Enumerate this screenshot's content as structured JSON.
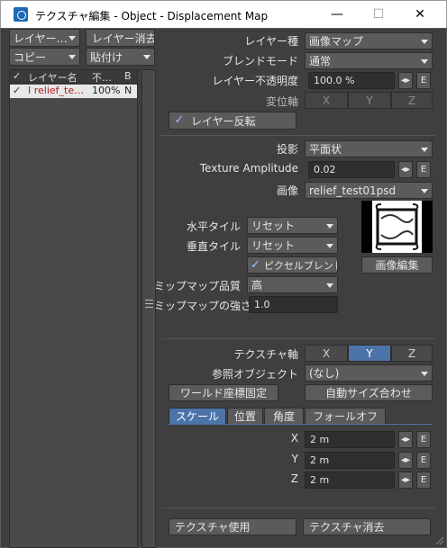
{
  "window": {
    "title": "テクスチャ編集 - Object - Displacement Map",
    "minimize": "—",
    "maximize": "☐",
    "close": "✕"
  },
  "left": {
    "layer_menu": "レイヤー…",
    "layer_delete": "レイヤー消去",
    "copy": "コピー",
    "paste": "貼付け",
    "col_check": "✓",
    "col_name": "レイヤー名",
    "col_opacity": "不…",
    "col_blend": "B",
    "rows": [
      {
        "check": "✓",
        "name": "I relief_te…",
        "opacity": "100%",
        "blend": "N"
      }
    ]
  },
  "layer": {
    "type_label": "レイヤー種",
    "type_value": "画像マップ",
    "blend_label": "ブレンドモード",
    "blend_value": "通常",
    "opacity_label": "レイヤー不透明度",
    "opacity_value": "100.0 %",
    "axis_label": "変位軸",
    "axis_x": "X",
    "axis_y": "Y",
    "axis_z": "Z",
    "invert_label": "レイヤー反転",
    "invert_check": "✓"
  },
  "image": {
    "projection_label": "投影",
    "projection_value": "平面状",
    "amp_label": "Texture Amplitude",
    "amp_value": "0.02",
    "image_label": "画像",
    "image_value": "relief_test01psd",
    "htile_label": "水平タイル",
    "htile_value": "リセット",
    "vtile_label": "垂直タイル",
    "vtile_value": "リセット",
    "pixel_blend_label": "ピクセルブレンド",
    "pixel_blend_check": "✓",
    "edit_image": "画像編集",
    "mip_quality_label": "ミップマップ品質",
    "mip_quality_value": "高",
    "mip_strength_label": "ミップマップの強さ",
    "mip_strength_value": "1.0"
  },
  "texture": {
    "axis_label": "テクスチャ軸",
    "axis_x": "X",
    "axis_y": "Y",
    "axis_z": "Z",
    "ref_label": "参照オブジェクト",
    "ref_value": "(なし)",
    "world_coords": "ワールド座標固定",
    "auto_size": "自動サイズ合わせ",
    "tabs": [
      "スケール",
      "位置",
      "角度",
      "フォールオフ"
    ],
    "x_label": "X",
    "x_value": "2 m",
    "y_label": "Y",
    "y_value": "2 m",
    "z_label": "Z",
    "z_value": "2 m",
    "use_texture": "テクスチャ使用",
    "delete_texture": "テクスチャ消去"
  },
  "env_label": "E",
  "colors": {
    "accent": "#4c74a8",
    "panel": "#3f3f3f",
    "field": "#2f2f2f"
  }
}
